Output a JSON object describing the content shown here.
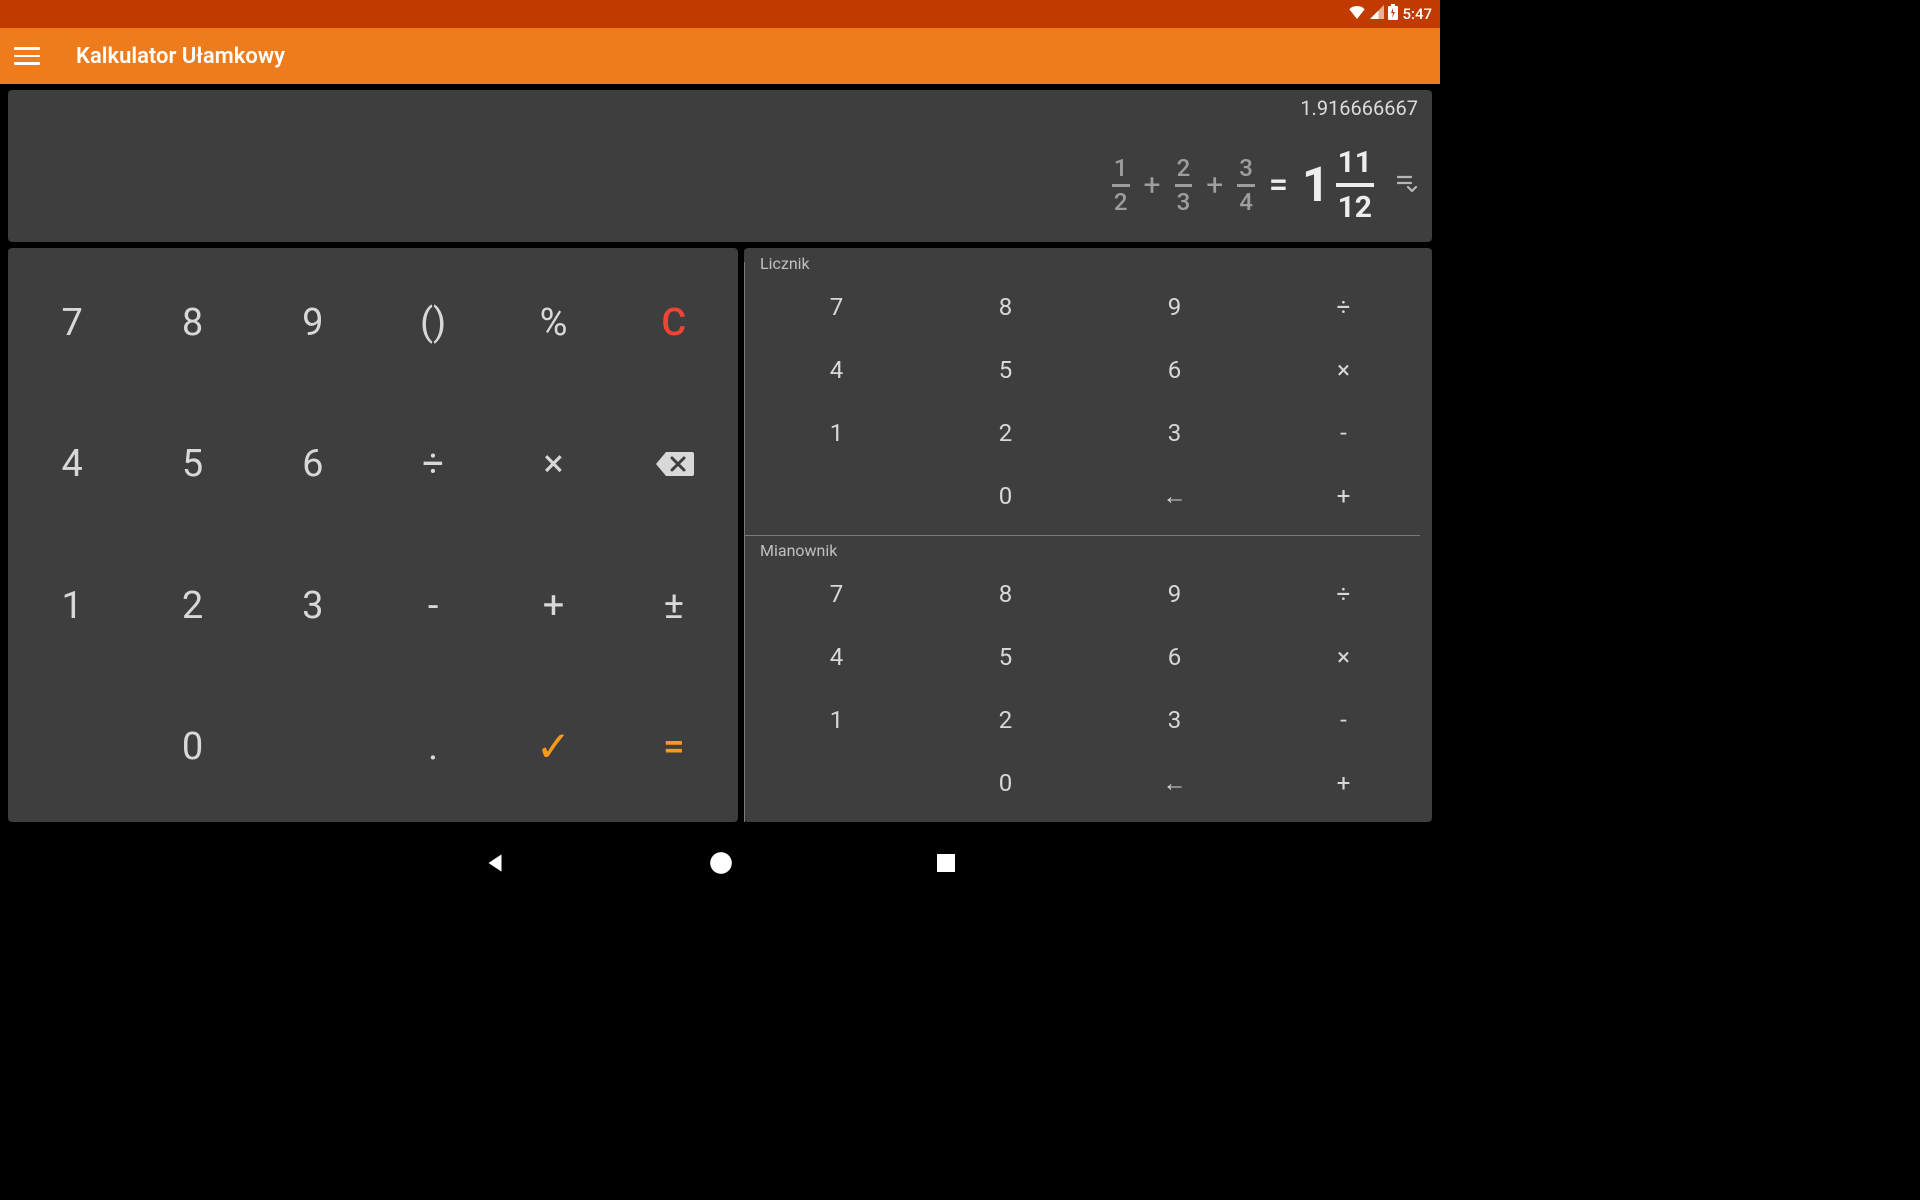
{
  "status_bar": {
    "time": "5:47"
  },
  "app": {
    "title": "Kalkulator Ułamkowy"
  },
  "display": {
    "decimal_result": "1.916666667",
    "fractions": [
      {
        "num": "1",
        "den": "2"
      },
      {
        "num": "2",
        "den": "3"
      },
      {
        "num": "3",
        "den": "4"
      }
    ],
    "op": "+",
    "equals": "=",
    "result": {
      "whole": "1",
      "num": "11",
      "den": "12"
    }
  },
  "main_pad": {
    "r0": [
      "7",
      "8",
      "9",
      "()",
      "%",
      "C"
    ],
    "r1": [
      "4",
      "5",
      "6",
      "÷",
      "×",
      "⌫"
    ],
    "r2": [
      "1",
      "2",
      "3",
      "-",
      "+",
      "±"
    ],
    "r3": [
      "",
      "0",
      "",
      ".",
      "✓",
      "="
    ]
  },
  "side": {
    "licznik_label": "Licznik",
    "mianownik_label": "Mianownik",
    "grid": {
      "r0": [
        "7",
        "8",
        "9",
        "÷"
      ],
      "r1": [
        "4",
        "5",
        "6",
        "×"
      ],
      "r2": [
        "1",
        "2",
        "3",
        "-"
      ],
      "r3": [
        "",
        "0",
        "←",
        "+"
      ]
    }
  }
}
